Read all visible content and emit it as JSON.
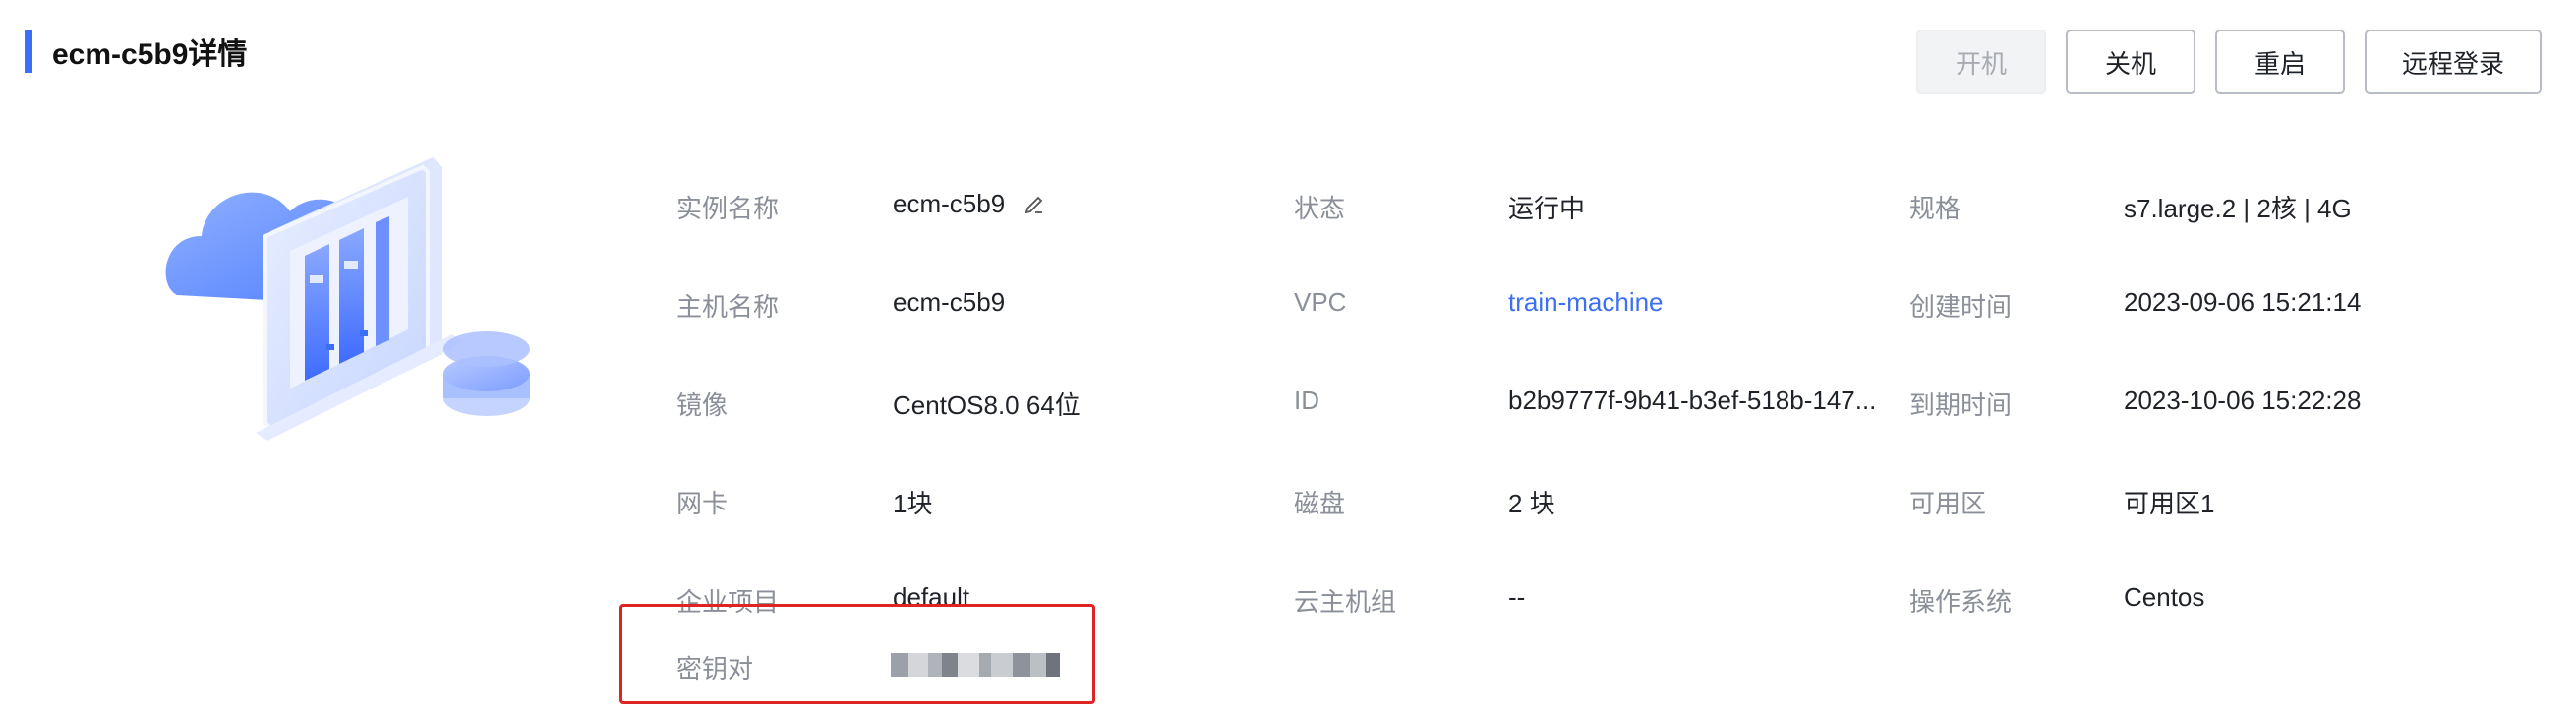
{
  "header": {
    "title": "ecm-c5b9详情"
  },
  "actions": {
    "start": "开机",
    "stop": "关机",
    "restart": "重启",
    "remote_login": "远程登录"
  },
  "fields": {
    "instance_name": {
      "label": "实例名称",
      "value": "ecm-c5b9"
    },
    "host_name": {
      "label": "主机名称",
      "value": "ecm-c5b9"
    },
    "image": {
      "label": "镜像",
      "value": "CentOS8.0 64位"
    },
    "nic": {
      "label": "网卡",
      "value": "1块"
    },
    "project": {
      "label": "企业项目",
      "value": "default"
    },
    "key_pair": {
      "label": "密钥对",
      "value": ""
    },
    "status": {
      "label": "状态",
      "value": "运行中"
    },
    "vpc": {
      "label": "VPC",
      "value": "train-machine"
    },
    "id": {
      "label": "ID",
      "value": "b2b9777f-9b41-b3ef-518b-147..."
    },
    "disk": {
      "label": "磁盘",
      "value": "2 块"
    },
    "group": {
      "label": "云主机组",
      "value": "--"
    },
    "spec": {
      "label": "规格",
      "value": "s7.large.2 | 2核 | 4G"
    },
    "created": {
      "label": "创建时间",
      "value": "2023-09-06 15:21:14"
    },
    "expires": {
      "label": "到期时间",
      "value": "2023-10-06 15:22:28"
    },
    "zone": {
      "label": "可用区",
      "value": "可用区1"
    },
    "os": {
      "label": "操作系统",
      "value": "Centos"
    }
  },
  "colors": {
    "accent": "#3b6ff5",
    "highlight": "#e02424",
    "label": "#8a8f99"
  }
}
